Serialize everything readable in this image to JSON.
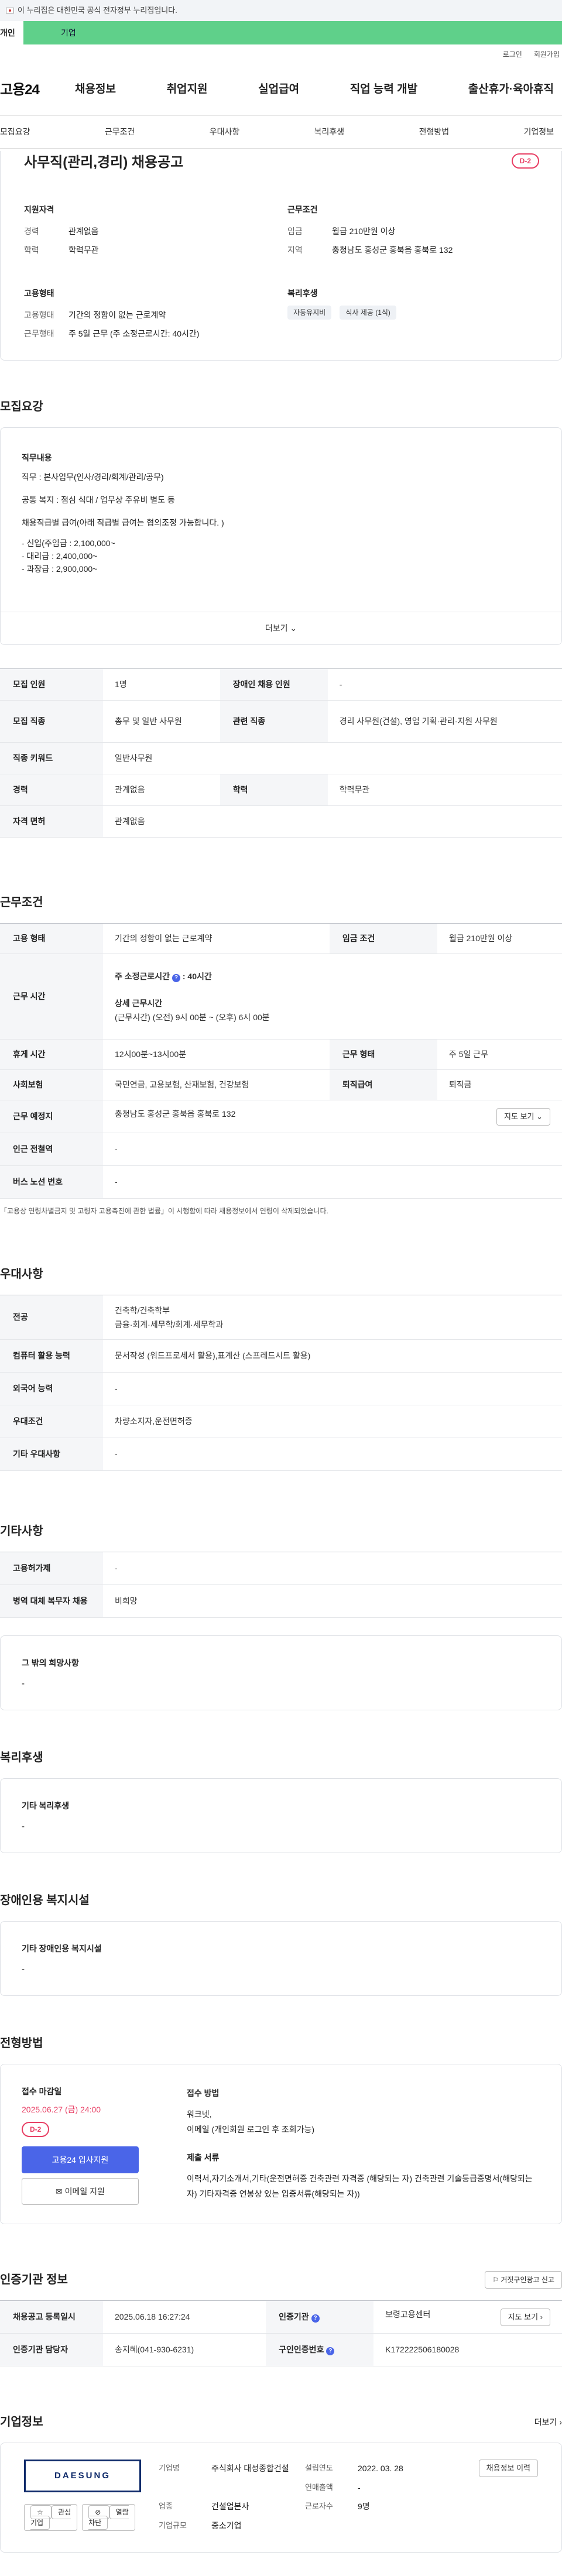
{
  "gov_notice": "이 누리집은 대한민국 공식 전자정부 누리집입니다.",
  "top_tabs": [
    "개인",
    "기업"
  ],
  "util_links": [
    "로그인",
    "회원가입"
  ],
  "logo": "고용24",
  "gnb": [
    "채용정보",
    "취업지원",
    "실업급여",
    "직업 능력 개발",
    "출산휴가·육아휴직"
  ],
  "subtabs": [
    "모집요강",
    "근무조건",
    "우대사항",
    "복리후생",
    "전형방법",
    "기업정보"
  ],
  "job": {
    "title": "사무직(관리,경리) 채용공고",
    "dday": "D-2",
    "qual_title": "지원자격",
    "qual": [
      {
        "k": "경력",
        "v": "관계없음"
      },
      {
        "k": "학력",
        "v": "학력무관"
      }
    ],
    "cond_title": "근무조건",
    "cond": [
      {
        "k": "임금",
        "v": "월급 210만원 이상"
      },
      {
        "k": "지역",
        "v": "충청남도 홍성군 홍북읍 홍북로 132"
      }
    ],
    "emp_title": "고용형태",
    "emp": [
      {
        "k": "고용형태",
        "v": "기간의 정함이 없는 근로계약"
      },
      {
        "k": "근무형태",
        "v": "주 5일 근무 (주 소정근로시간: 40시간)"
      }
    ],
    "welfare_title": "복리후생",
    "welfare": [
      "자동유지비",
      "식사 제공 (1식)"
    ]
  },
  "recruit": {
    "title": "모집요강",
    "desc_title": "직무내용",
    "desc_lines": [
      "직무 : 본사업무(인사/경리/회계/관리/공무)",
      "공통 복지 : 점심 식대 / 업무상 주유비 별도 등",
      "채용직급별 급여(아래 직급별 급여는 협의조정 가능합니다. )",
      "- 신입(주임급 : 2,100,000~",
      "- 대리급 : 2,400,000~",
      "- 과장급 : 2,900,000~"
    ],
    "more": "더보기",
    "rows": [
      [
        {
          "k": "모집 인원",
          "v": "1명"
        },
        {
          "k": "장애인 채용 인원",
          "v": "-"
        }
      ],
      [
        {
          "k": "모집 직종",
          "v": "총무 및 일반 사무원"
        },
        {
          "k": "관련 직종",
          "v": "경리 사무원(건설), 영업 기획·관리·지원 사무원"
        }
      ],
      [
        {
          "k": "직종 키워드",
          "v": "일반사무원"
        }
      ],
      [
        {
          "k": "경력",
          "v": "관계없음"
        },
        {
          "k": "학력",
          "v": "학력무관"
        }
      ],
      [
        {
          "k": "자격 면허",
          "v": "관계없음"
        }
      ]
    ]
  },
  "work": {
    "title": "근무조건",
    "type_k": "고용 형태",
    "type_v": "기간의 정함이 없는 근로계약",
    "wage_k": "임금 조건",
    "wage_v": "월급 210만원 이상",
    "hours_k": "근무 시간",
    "hours_title": "주 소정근로시간",
    "hours_val": "40시간",
    "hours_detail_title": "상세 근무시간",
    "hours_detail": "(근무시간) (오전) 9시 00분 ~ (오후) 6시 00분",
    "rest_k": "휴게 시간",
    "rest_v": "12시00분~13시00분",
    "shift_k": "근무 형태",
    "shift_v": "주 5일 근무",
    "ins_k": "사회보험",
    "ins_v": "국민연금, 고용보험, 산재보험, 건강보험",
    "retire_k": "퇴직급여",
    "retire_v": "퇴직금",
    "place_k": "근무 예정지",
    "place_v": "충청남도 홍성군 홍북읍 홍북로 132",
    "map_btn": "지도 보기",
    "subway_k": "인근 전철역",
    "subway_v": "-",
    "bus_k": "버스 노선 번호",
    "bus_v": "-",
    "note": "「고용상 연령차별금지 및 고령자 고용촉진에 관한 법률」이 시행함에 따라 채용정보에서 연령이 삭제되었습니다."
  },
  "pref": {
    "title": "우대사항",
    "rows": [
      {
        "k": "전공",
        "v": "건축학/건축학부\n금융·회계·세무학/회계·세무학과"
      },
      {
        "k": "컴퓨터 활용 능력",
        "v": "문서작성 (워드프로세서 활용),표계산 (스프레드시트 활용)"
      },
      {
        "k": "외국어 능력",
        "v": "-"
      },
      {
        "k": "우대조건",
        "v": "차량소지자,운전면허증"
      },
      {
        "k": "기타 우대사항",
        "v": "-"
      }
    ]
  },
  "etc": {
    "title": "기타사항",
    "rows": [
      {
        "k": "고용허가제",
        "v": "-"
      },
      {
        "k": "병역 대체 복무자 채용",
        "v": "비희망"
      }
    ],
    "box_title": "그 밖의 희망사항",
    "box_val": "-"
  },
  "benefit": {
    "title": "복리후생",
    "box_title": "기타 복리후생",
    "box_val": "-"
  },
  "disabled": {
    "title": "장애인용 복지시설",
    "box_title": "기타 장애인용 복지시설",
    "box_val": "-"
  },
  "apply": {
    "title": "전형방법",
    "deadline_title": "접수 마감일",
    "deadline": "2025.06.27 (금) 24:00",
    "dday": "D-2",
    "btn_apply": "고용24 입사지원",
    "btn_email": "이메일 지원",
    "method_title": "접수 방법",
    "method": "워크넷,\n이메일 (개인회원 로그인 후 조회가능)",
    "docs_title": "제출 서류",
    "docs": "이력서,자기소개서,기타(운전면허증 건축관련 자격증 (해당되는 자) 건축관련 기술등급증명서(해당되는 자) 기타자격증 연봉상 있는 입증서류(해당되는 자))"
  },
  "cert": {
    "title": "인증기관 정보",
    "report_btn": "거짓구인광고 신고",
    "rows": [
      [
        {
          "k": "채용공고 등록일시",
          "v": "2025.06.18 16:27:24"
        },
        {
          "k": "인증기관",
          "v": "보령고용센터",
          "btn": "지도 보기"
        }
      ],
      [
        {
          "k": "인증기관 담당자",
          "v": "송지혜(041-930-6231)"
        },
        {
          "k": "구인인증번호",
          "v": "K172222506180028"
        }
      ]
    ]
  },
  "company": {
    "title": "기업정보",
    "more": "더보기",
    "logo_text": "DAESUNG",
    "btn_fav": "관심기업",
    "btn_block": "열람차단",
    "btn_other": "채용정보 이력",
    "info": [
      {
        "k": "기업명",
        "v": "주식회사 대성종합건설"
      },
      {
        "k": "설립연도",
        "v": "2022. 03. 28"
      },
      {
        "k": "연매출액",
        "v": "-"
      },
      {
        "k": "업종",
        "v": "건설업본사"
      },
      {
        "k": "근로자수",
        "v": "9명"
      },
      {
        "k": "기업규모",
        "v": "중소기업"
      }
    ]
  }
}
